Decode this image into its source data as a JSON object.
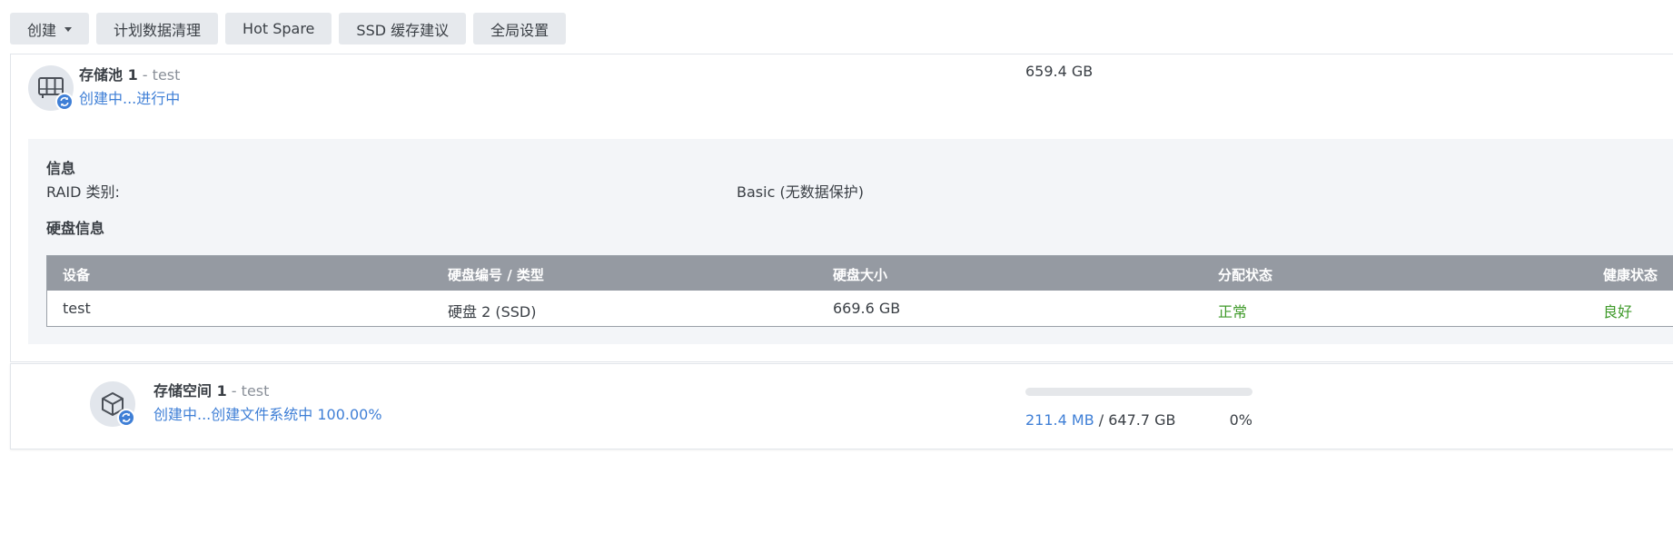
{
  "toolbar": {
    "create_label": "创建",
    "scrub_label": "计划数据清理",
    "hotspare_label": "Hot Spare",
    "ssd_label": "SSD 缓存建议",
    "global_label": "全局设置"
  },
  "pool": {
    "name": "存储池 1",
    "separator": " - ",
    "description": "test",
    "status": "创建中...进行中",
    "size": "659.4 GB",
    "icon": "nas-drive-icon",
    "badge_icon": "sync-icon",
    "info_title": "信息",
    "raid_label": "RAID 类别:",
    "raid_value": "Basic (无数据保护)",
    "disk_info_title": "硬盘信息",
    "table": {
      "headers": [
        "设备",
        "硬盘编号 / 类型",
        "硬盘大小",
        "分配状态",
        "健康状态"
      ],
      "rows": [
        [
          "test",
          "硬盘 2 (SSD)",
          "669.6 GB",
          "正常",
          "良好"
        ]
      ]
    }
  },
  "volume": {
    "name": "存储空间 1",
    "separator": " - ",
    "description": "test",
    "status": "创建中...创建文件系统中 100.00%",
    "used": "211.4 MB",
    "slash": " / ",
    "total": "647.7 GB",
    "percent": "0%",
    "progress_fraction": 0.0003,
    "icon": "cube-icon",
    "badge_icon": "sync-icon"
  },
  "colors": {
    "accent": "#3f7fd6",
    "ok": "#3f9a2a",
    "table_header": "#959aa2"
  }
}
